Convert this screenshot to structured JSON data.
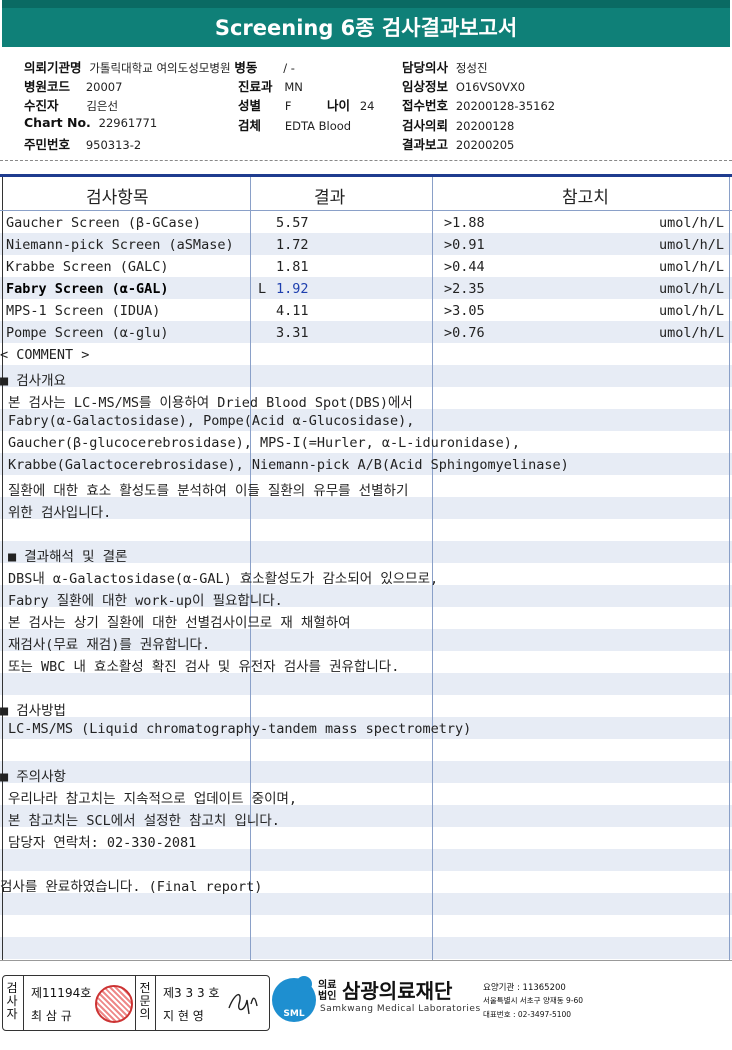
{
  "title": "Screening 6종 검사결과보고서",
  "header": {
    "col1": [
      {
        "label": "의뢰기관명",
        "value": "가톨릭대학교 여의도성모병원"
      },
      {
        "label": "병원코드",
        "value": "20007"
      },
      {
        "label": "수진자",
        "value": "김은선"
      },
      {
        "label": "Chart No.",
        "value": "22961771"
      },
      {
        "label": "주민번호",
        "value": "950313-2"
      }
    ],
    "ward_label": "병동",
    "ward_value": "/ -",
    "dept_label": "진료과",
    "dept_value": "MN",
    "sex_label": "성별",
    "sex_value": "F",
    "age_label": "나이",
    "age_value": "24",
    "specimen_label": "검체",
    "specimen_value": "EDTA Blood",
    "col3": [
      {
        "label": "담당의사",
        "value": "정성진"
      },
      {
        "label": "임상정보",
        "value": "O16VS0VX0"
      },
      {
        "label": "접수번호",
        "value": "20200128-35162"
      },
      {
        "label": "검사의뢰",
        "value": "20200128"
      },
      {
        "label": "결과보고",
        "value": "20200205"
      }
    ]
  },
  "table": {
    "headers": {
      "item": "검사항목",
      "result": "결과",
      "ref": "참고치"
    },
    "rows": [
      {
        "item": "Gaucher Screen (β-GCase)",
        "flag": "",
        "result": "5.57",
        "ref": ">1.88",
        "unit": "umol/h/L"
      },
      {
        "item": "Niemann-pick Screen (aSMase)",
        "flag": "",
        "result": "1.72",
        "ref": ">0.91",
        "unit": "umol/h/L"
      },
      {
        "item": "Krabbe Screen (GALC)",
        "flag": "",
        "result": "1.81",
        "ref": ">0.44",
        "unit": "umol/h/L"
      },
      {
        "item": "Fabry Screen (α-GAL)",
        "flag": "L",
        "result": "1.92",
        "ref": ">2.35",
        "unit": "umol/h/L"
      },
      {
        "item": "MPS-1 Screen (IDUA)",
        "flag": "",
        "result": "4.11",
        "ref": ">3.05",
        "unit": "umol/h/L"
      },
      {
        "item": "Pompe Screen (α-glu)",
        "flag": "",
        "result": "3.31",
        "ref": ">0.76",
        "unit": "umol/h/L"
      }
    ]
  },
  "comment": {
    "heading": "< COMMENT >",
    "s1_title": "■ 검사개요",
    "s1_lines": [
      "본 검사는 LC-MS/MS를 이용하여 Dried Blood Spot(DBS)에서",
      "Fabry(α-Galactosidase), Pompe(Acid α-Glucosidase),",
      "Gaucher(β-glucocerebrosidase), MPS-I(=Hurler, α-L-iduronidase),",
      "Krabbe(Galactocerebrosidase), Niemann-pick A/B(Acid Sphingomyelinase)",
      "질환에 대한 효소 활성도를 분석하여 이들 질환의 유무를 선별하기",
      "위한 검사입니다."
    ],
    "s2_title": "■ 결과해석 및 결론",
    "s2_lines": [
      "DBS내 α-Galactosidase(α-GAL) 효소활성도가 감소되어 있으므로,",
      "Fabry 질환에 대한 work-up이 필요합니다.",
      "본 검사는 상기 질환에 대한 선별검사이므로 재 채혈하여",
      "재검사(무료 재검)를 권유합니다.",
      "또는 WBC 내 효소활성 확진 검사 및 유전자 검사를 권유합니다."
    ],
    "s3_title": "■ 검사방법",
    "s3_lines": [
      "LC-MS/MS (Liquid chromatography-tandem mass spectrometry)"
    ],
    "s4_title": "■ 주의사항",
    "s4_lines": [
      "우리나라 참고치는 지속적으로 업데이트 중이며,",
      "본 참고치는 SCL에서 설정한 참고치 입니다.",
      "담당자 연락처: 02-330-2081"
    ],
    "final": "검사를  완료하였습니다. (Final report)"
  },
  "footer": {
    "box1_vlabel": "검사자",
    "box1_license": "제11194호",
    "box1_name": "최 삼 규",
    "box2_vlabel": "전문의",
    "box2_license": "제3 3 3 호",
    "box2_name": "지 현 영",
    "logo_small": "SML",
    "org_type": "의료법인",
    "org_name": "삼광의료재단",
    "org_en": "Samkwang Medical Laboratories",
    "org_code": "요양기관 : 11365200",
    "org_addr": "서울특별시 서초구 양재동 9-60",
    "org_tel": "대표번호 : 02-3497-5100"
  }
}
